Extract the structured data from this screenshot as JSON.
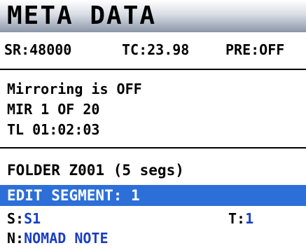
{
  "header": {
    "title": "META DATA"
  },
  "status": {
    "sample_rate": "SR:48000",
    "timecode": "TC:23.98",
    "pre": "PRE:OFF"
  },
  "mirror": {
    "state": "Mirroring is OFF",
    "count": "MIR 1 OF 20",
    "timeline": "TL 01:02:03"
  },
  "folder": {
    "label": "FOLDER Z001 (5 segs)"
  },
  "edit": {
    "label": "EDIT SEGMENT: 1"
  },
  "fields": {
    "scene_label": "S:",
    "scene_value": "S1",
    "take_label": "T:",
    "take_value": "1",
    "note_label": "N:",
    "note_value": "NOMAD NOTE"
  },
  "colors": {
    "highlight": "#2d6fd9",
    "value_text": "#1a3fc4",
    "header_gradient_end": "#8a96a8"
  }
}
